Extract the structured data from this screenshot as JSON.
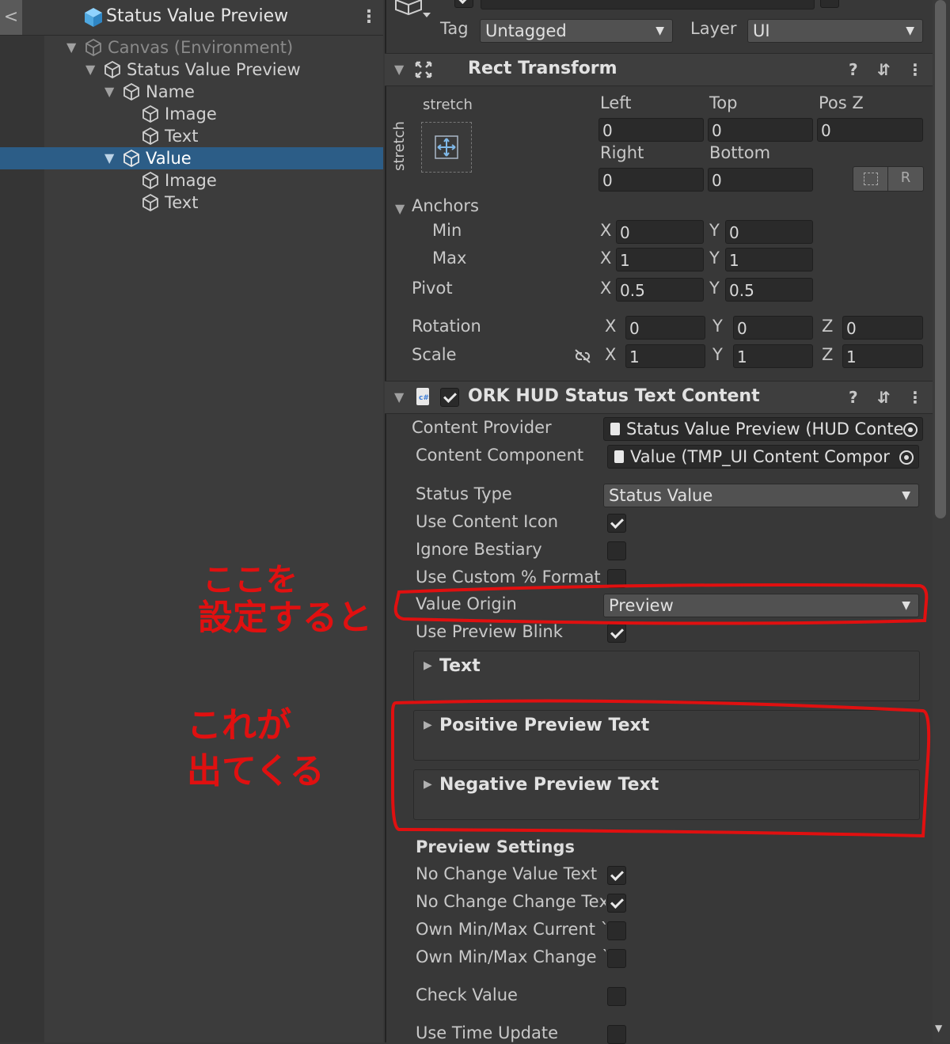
{
  "hierarchy": {
    "back": "<",
    "title": "Status Value Preview",
    "menu": "⋮",
    "items": [
      {
        "label": "Canvas (Environment)"
      },
      {
        "label": "Status Value Preview"
      },
      {
        "label": "Name"
      },
      {
        "label": "Image"
      },
      {
        "label": "Text"
      },
      {
        "label": "Value"
      },
      {
        "label": "Image"
      },
      {
        "label": "Text"
      }
    ]
  },
  "inspector": {
    "top": {
      "tag_label": "Tag",
      "tag_value": "Untagged",
      "layer_label": "Layer",
      "layer_value": "UI"
    },
    "rect_transform": {
      "title": "Rect Transform",
      "stretch_h": "stretch",
      "stretch_v": "stretch",
      "left_label": "Left",
      "left": "0",
      "top_label": "Top",
      "top": "0",
      "posz_label": "Pos Z",
      "posz": "0",
      "right_label": "Right",
      "right": "0",
      "bottom_label": "Bottom",
      "bottom": "0",
      "r_button": "R",
      "anchors_label": "Anchors",
      "min_label": "Min",
      "min_x": "0",
      "min_y": "0",
      "max_label": "Max",
      "max_x": "1",
      "max_y": "1",
      "pivot_label": "Pivot",
      "pivot_x": "0.5",
      "pivot_y": "0.5",
      "rotation_label": "Rotation",
      "rot_x": "0",
      "rot_y": "0",
      "rot_z": "0",
      "scale_label": "Scale",
      "scale_x": "1",
      "scale_y": "1",
      "scale_z": "1",
      "x": "X",
      "y": "Y",
      "z": "Z"
    },
    "ork": {
      "title": "ORK HUD Status Text Content",
      "content_provider_label": "Content Provider",
      "content_provider_value": "Status Value Preview (HUD Conte",
      "content_component_label": "Content Component",
      "content_component_value": "Value (TMP_UI Content Compor",
      "status_type_label": "Status Type",
      "status_type_value": "Status Value",
      "use_content_icon_label": "Use Content Icon",
      "ignore_bestiary_label": "Ignore Bestiary",
      "use_custom_format_label": "Use Custom % Format",
      "value_origin_label": "Value Origin",
      "value_origin_value": "Preview",
      "use_preview_blink_label": "Use Preview Blink",
      "text_fold": "Text",
      "positive_fold": "Positive Preview Text",
      "negative_fold": "Negative Preview Text",
      "preview_settings_label": "Preview Settings",
      "no_change_value_label": "No Change Value Text",
      "no_change_change_label": "No Change Change Teх",
      "own_minmax_current_label": "Own Min/Max Current `",
      "own_minmax_change_label": "Own Min/Max Change `",
      "check_value_label": "Check Value",
      "use_time_update_label": "Use Time Update"
    }
  },
  "annotations": {
    "note1_line1": "ここを",
    "note1_line2": "設定すると",
    "note2_line1": "これが",
    "note2_line2": "出てくる"
  },
  "colors": {
    "selection": "#2c5d87",
    "annotation": "#e01010",
    "panel": "#383838"
  }
}
